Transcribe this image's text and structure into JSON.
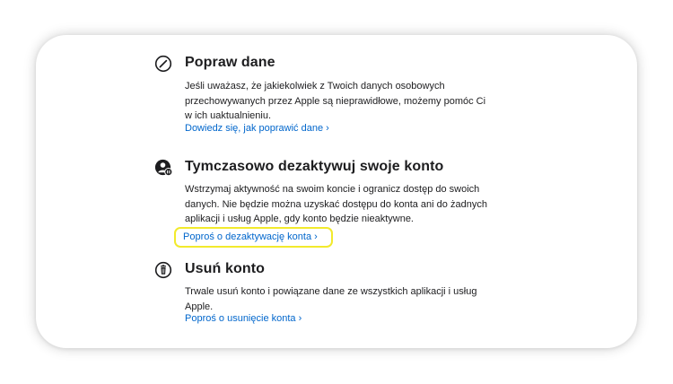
{
  "sections": [
    {
      "icon": "pencil-circle-icon",
      "title": "Popraw dane",
      "body": "Jeśli uważasz, że jakiekolwiek z Twoich danych osobowych przechowywanych przez Apple są nieprawidłowe, możemy pomóc Ci w ich uaktualnieniu.",
      "link": "Dowiedz się, jak poprawić dane ›"
    },
    {
      "icon": "person-pause-icon",
      "title": "Tymczasowo dezaktywuj swoje konto",
      "body": "Wstrzymaj aktywność na swoim koncie i ogranicz dostęp do swoich danych. Nie będzie można uzyskać dostępu do konta ani do żadnych aplikacji i usług Apple, gdy konto będzie nieaktywne.",
      "link": "Poproś o dezaktywację konta ›"
    },
    {
      "icon": "trash-circle-icon",
      "title": "Usuń konto",
      "body": "Trwale usuń konto i powiązane dane ze wszystkich aplikacji i usług Apple.",
      "link": "Poproś o usunięcie konta ›"
    }
  ],
  "colors": {
    "text": "#1d1d1f",
    "link": "#0066cc",
    "highlight": "#f2ea2c"
  }
}
